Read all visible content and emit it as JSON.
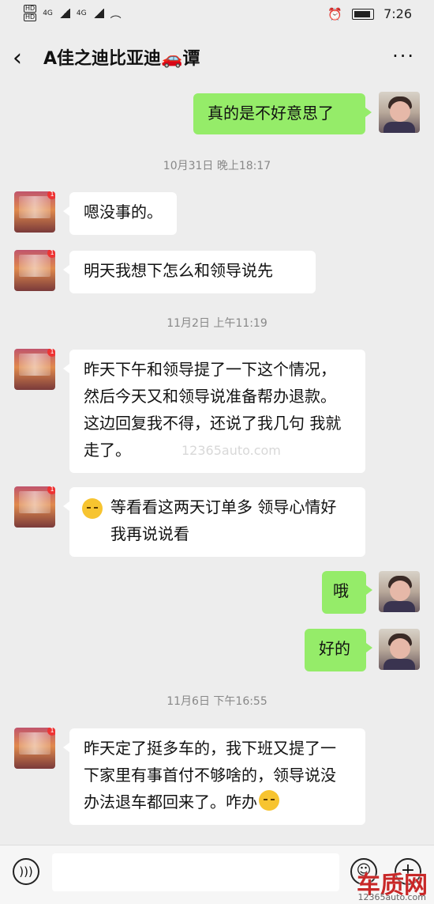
{
  "status_bar": {
    "net1": "HD",
    "net2": "HD",
    "sig1": "4G",
    "sig2": "4G",
    "time": "7:26"
  },
  "header": {
    "title": "A佳之迪比亚迪🚗谭",
    "more": "···"
  },
  "messages": [
    {
      "type": "right",
      "text": "真的是不好意思了"
    },
    {
      "type": "time",
      "text": "10月31日 晚上18:17"
    },
    {
      "type": "left",
      "text": "嗯没事的。"
    },
    {
      "type": "left",
      "text": "明天我想下怎么和领导说先"
    },
    {
      "type": "time",
      "text": "11月2日 上午11:19"
    },
    {
      "type": "left",
      "text": " 昨天下午和领导提了一下这个情况，然后今天又和领导说准备帮办退款。这边回复我不得，还说了我几句 我就走了。"
    },
    {
      "type": "left",
      "text": "等看看这两天订单多 领导心情好我再说说看"
    },
    {
      "type": "right",
      "text": "哦"
    },
    {
      "type": "right",
      "text": "好的"
    },
    {
      "type": "time",
      "text": "11月6日 下午16:55"
    },
    {
      "type": "left",
      "text": "昨天定了挺多车的，我下班又提了一下家里有事首付不够啥的，领导说没办法退车都回来了。咋办"
    }
  ],
  "input_bar": {
    "voice_icon": "voice-icon",
    "emoji_icon": "emoji-icon",
    "plus_icon": "plus-icon"
  },
  "watermark": {
    "mid": "12365auto.com",
    "logo": "车质网",
    "url": "12365auto.com"
  }
}
